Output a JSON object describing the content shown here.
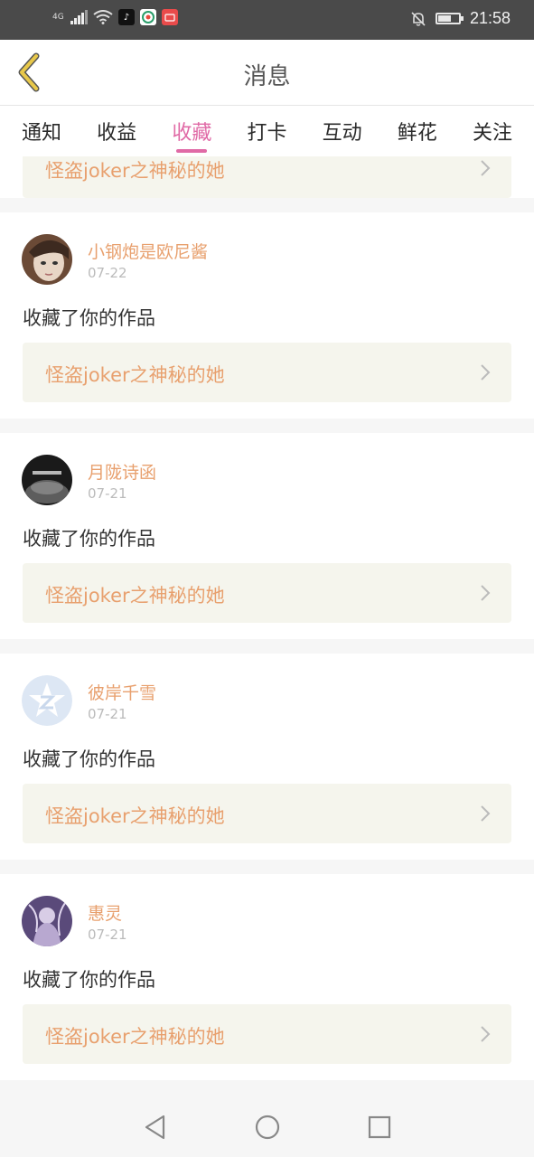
{
  "status_bar": {
    "network": "4G",
    "time": "21:58"
  },
  "header": {
    "title": "消息"
  },
  "tabs": [
    {
      "label": "通知"
    },
    {
      "label": "收益"
    },
    {
      "label": "收藏"
    },
    {
      "label": "打卡"
    },
    {
      "label": "互动"
    },
    {
      "label": "鲜花"
    },
    {
      "label": "关注"
    }
  ],
  "active_tab": "收藏",
  "partial_entry": {
    "work_title": "怪盗joker之神秘的她"
  },
  "entries": [
    {
      "user": "小钢炮是欧尼酱",
      "date": "07-22",
      "action": "收藏了你的作品",
      "work_title": "怪盗joker之神秘的她"
    },
    {
      "user": "月陇诗函",
      "date": "07-21",
      "action": "收藏了你的作品",
      "work_title": "怪盗joker之神秘的她"
    },
    {
      "user": "彼岸千雪",
      "date": "07-21",
      "action": "收藏了你的作品",
      "work_title": "怪盗joker之神秘的她"
    },
    {
      "user": "惠灵",
      "date": "07-21",
      "action": "收藏了你的作品",
      "work_title": "怪盗joker之神秘的她"
    }
  ],
  "colors": {
    "accent": "#e06aa6",
    "name": "#e8a06e",
    "link_bg": "#f5f5ed",
    "back_icon": "#e8c84a"
  },
  "icons": {
    "back": "chevron-left-icon",
    "row_arrow": "chevron-right-icon",
    "nav": [
      "back-triangle-icon",
      "home-circle-icon",
      "recent-square-icon"
    ]
  }
}
